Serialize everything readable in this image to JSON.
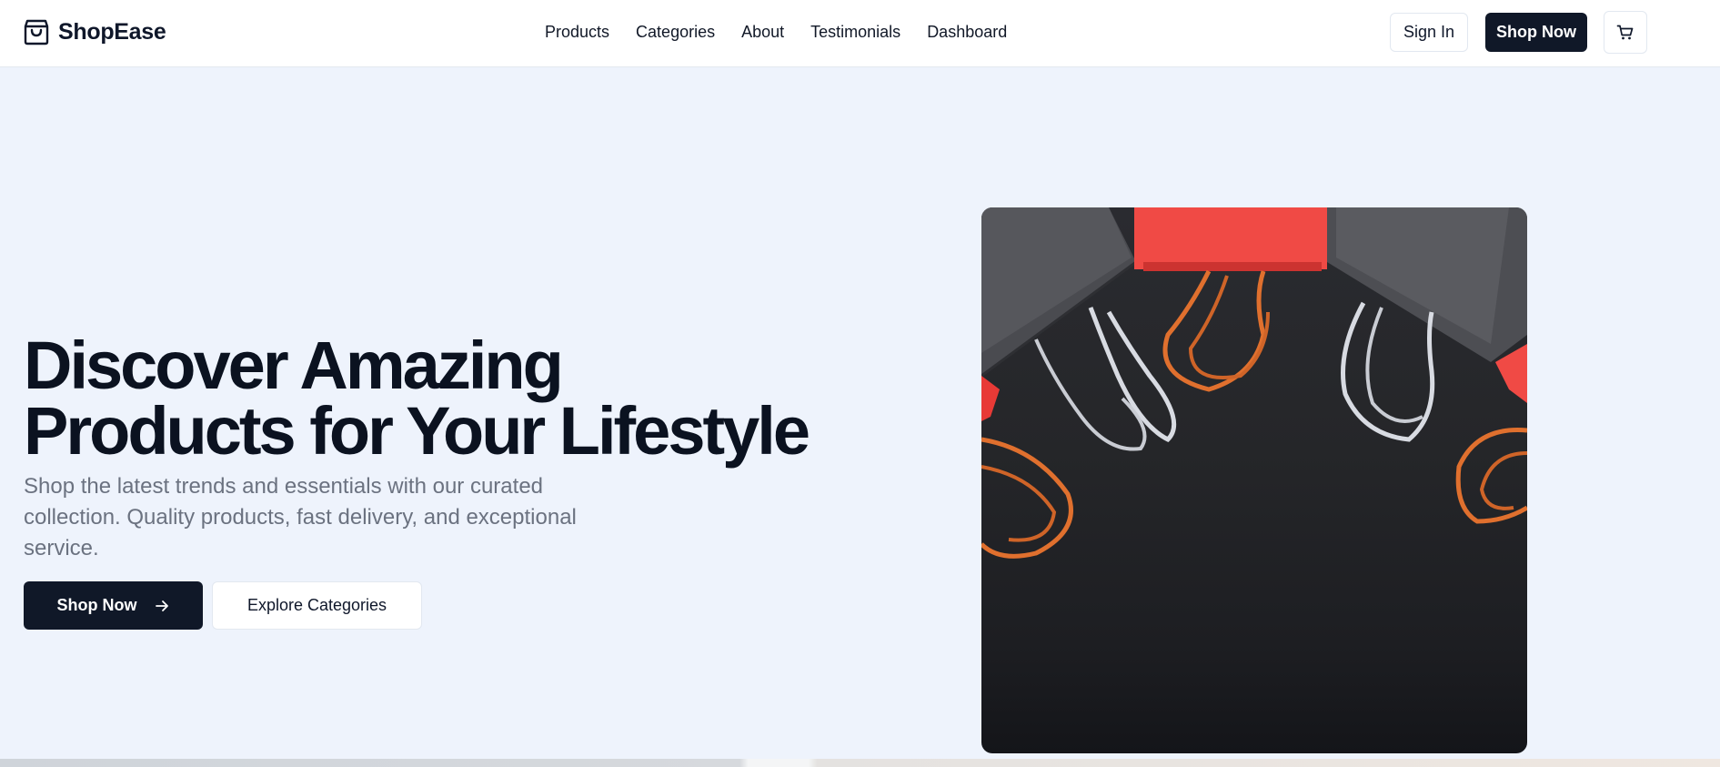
{
  "brand": {
    "name": "ShopEase",
    "icon": "shopping-bag-icon"
  },
  "nav": {
    "items": [
      {
        "label": "Products"
      },
      {
        "label": "Categories"
      },
      {
        "label": "About"
      },
      {
        "label": "Testimonials"
      },
      {
        "label": "Dashboard"
      }
    ]
  },
  "header_actions": {
    "sign_in_label": "Sign In",
    "shop_now_label": "Shop Now",
    "cart_icon": "shopping-cart-icon"
  },
  "hero": {
    "title_line1": "Discover Amazing",
    "title_line2": "Products for Your Lifestyle",
    "subtitle_line1": "Shop the latest trends and essentials with our curated",
    "subtitle_line2": "collection. Quality products, fast delivery, and exceptional",
    "subtitle_line3": "service.",
    "primary_button_label": "Shop Now",
    "primary_button_icon": "arrow-right-icon",
    "secondary_button_label": "Explore Categories",
    "image_subject": "shopping-bags-photo"
  },
  "colors": {
    "page_background": "#eef3fc",
    "header_background": "#ffffff",
    "primary_dark": "#101828",
    "heading_text": "#0b1220",
    "muted_text": "#6b7280",
    "bag_red": "#f04a45",
    "bag_gray": "#4a4b50",
    "rope_orange": "#e0702e",
    "rope_white": "#d8dbe2"
  }
}
